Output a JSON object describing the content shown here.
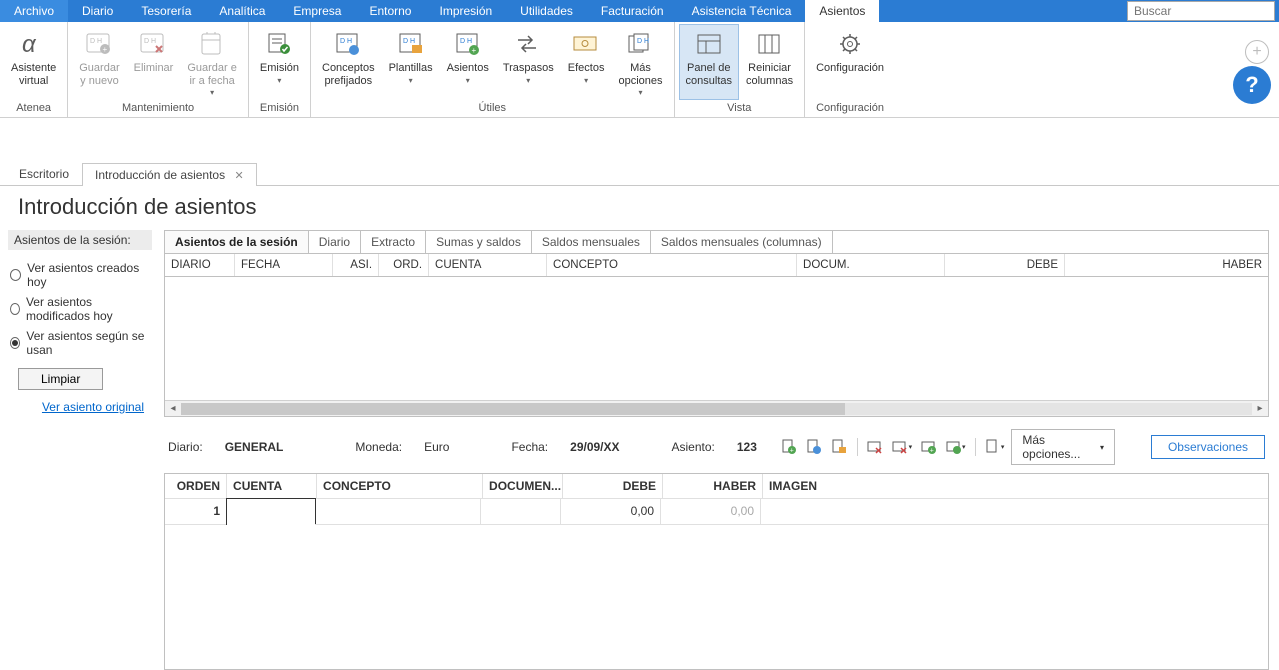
{
  "search_placeholder": "Buscar",
  "menubar": [
    "Archivo",
    "Diario",
    "Tesorería",
    "Analítica",
    "Empresa",
    "Entorno",
    "Impresión",
    "Utilidades",
    "Facturación",
    "Asistencia Técnica",
    "Asientos"
  ],
  "menubar_active": 10,
  "ribbon": {
    "atenea": {
      "label": "Asistente\nvirtual",
      "group": "Atenea"
    },
    "mant": {
      "guardar": "Guardar\ny nuevo",
      "eliminar": "Eliminar",
      "irfecha": "Guardar e\nir a fecha",
      "group": "Mantenimiento"
    },
    "emision": {
      "label": "Emisión",
      "group": "Emisión"
    },
    "utiles": {
      "conceptos": "Conceptos\nprefijados",
      "plantillas": "Plantillas",
      "asientos": "Asientos",
      "traspasos": "Traspasos",
      "efectos": "Efectos",
      "mas": "Más\nopciones",
      "group": "Útiles"
    },
    "vista": {
      "panel": "Panel de\nconsultas",
      "reiniciar": "Reiniciar\ncolumnas",
      "group": "Vista"
    },
    "config": {
      "label": "Configuración",
      "group": "Configuración"
    }
  },
  "doctabs": {
    "escritorio": "Escritorio",
    "intro": "Introducción de asientos"
  },
  "page_title": "Introducción de asientos",
  "side": {
    "header": "Asientos de la sesión:",
    "r1": "Ver asientos creados hoy",
    "r2": "Ver asientos modificados hoy",
    "r3": "Ver asientos según se usan",
    "limpiar": "Limpiar",
    "link": "Ver asiento original"
  },
  "innertabs": [
    "Asientos de la sesión",
    "Diario",
    "Extracto",
    "Sumas y saldos",
    "Saldos mensuales",
    "Saldos mensuales (columnas)"
  ],
  "gridcols": [
    "DIARIO",
    "FECHA",
    "ASI.",
    "ORD.",
    "CUENTA",
    "CONCEPTO",
    "DOCUM.",
    "DEBE",
    "HABER"
  ],
  "form": {
    "diario_l": "Diario:",
    "diario_v": "GENERAL",
    "moneda_l": "Moneda:",
    "moneda_v": "Euro",
    "fecha_l": "Fecha:",
    "fecha_v": "29/09/XX",
    "asiento_l": "Asiento:",
    "asiento_v": "123",
    "moreopts": "Más opciones...",
    "obs": "Observaciones"
  },
  "egridcols": [
    "ORDEN",
    "CUENTA",
    "CONCEPTO",
    "DOCUMEN...",
    "DEBE",
    "HABER",
    "IMAGEN"
  ],
  "erow": {
    "orden": "1",
    "debe": "0,00",
    "haber": "0,00"
  }
}
